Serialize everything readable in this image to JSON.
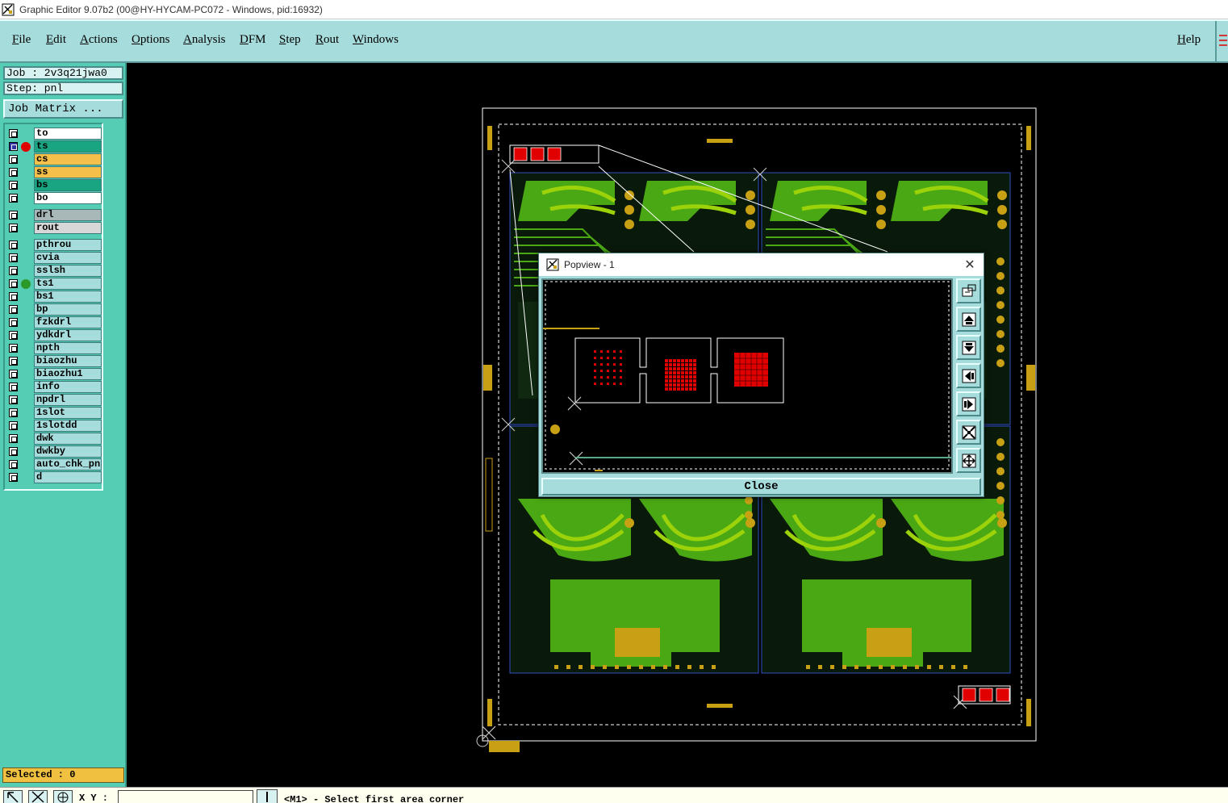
{
  "window": {
    "title": "Graphic Editor 9.07b2 (00@HY-HYCAM-PC072 - Windows, pid:16932)"
  },
  "menu": {
    "items": [
      "File",
      "Edit",
      "Actions",
      "Options",
      "Analysis",
      "DFM",
      "Step",
      "Rout",
      "Windows"
    ],
    "help": "Help"
  },
  "job": {
    "job_label": "Job : 2v3q21jwa0",
    "step_label": "Step: pnl",
    "matrix_button": "Job Matrix ..."
  },
  "layers": [
    {
      "name": "to",
      "color": "#ffffff",
      "dot": ""
    },
    {
      "name": "ts",
      "color": "#1aa582",
      "dot": "#e00000",
      "active": true
    },
    {
      "name": "cs",
      "color": "#f5c04a",
      "dot": ""
    },
    {
      "name": "ss",
      "color": "#f5c04a",
      "dot": ""
    },
    {
      "name": "bs",
      "color": "#1aa582",
      "dot": ""
    },
    {
      "name": "bo",
      "color": "#ffffff",
      "dot": ""
    },
    {
      "name": "drl",
      "color": "#a8b8b8",
      "dot": ""
    },
    {
      "name": "rout",
      "color": "#d8d8d8",
      "dot": ""
    },
    {
      "name": "pthrou",
      "color": "#a6dcdc",
      "dot": ""
    },
    {
      "name": "cvia",
      "color": "#a6dcdc",
      "dot": ""
    },
    {
      "name": "sslsh",
      "color": "#a6dcdc",
      "dot": ""
    },
    {
      "name": "ts1",
      "color": "#a6dcdc",
      "dot": "#2a9a2a"
    },
    {
      "name": "bs1",
      "color": "#a6dcdc",
      "dot": ""
    },
    {
      "name": "bp",
      "color": "#a6dcdc",
      "dot": ""
    },
    {
      "name": "fzkdrl",
      "color": "#a6dcdc",
      "dot": ""
    },
    {
      "name": "ydkdrl",
      "color": "#a6dcdc",
      "dot": ""
    },
    {
      "name": "npth",
      "color": "#a6dcdc",
      "dot": ""
    },
    {
      "name": "biaozhu",
      "color": "#a6dcdc",
      "dot": ""
    },
    {
      "name": "biaozhu1",
      "color": "#a6dcdc",
      "dot": ""
    },
    {
      "name": "info",
      "color": "#a6dcdc",
      "dot": ""
    },
    {
      "name": "npdrl",
      "color": "#a6dcdc",
      "dot": ""
    },
    {
      "name": "1slot",
      "color": "#a6dcdc",
      "dot": ""
    },
    {
      "name": "1slotdd",
      "color": "#a6dcdc",
      "dot": ""
    },
    {
      "name": "dwk",
      "color": "#a6dcdc",
      "dot": ""
    },
    {
      "name": "dwkby",
      "color": "#a6dcdc",
      "dot": ""
    },
    {
      "name": "auto_chk_pnl",
      "color": "#a6dcdc",
      "dot": ""
    },
    {
      "name": "d",
      "color": "#a6dcdc",
      "dot": ""
    }
  ],
  "selected": "Selected : 0",
  "status": {
    "xy_label": "X Y :",
    "message": "<M1> - Select first area corner"
  },
  "popview": {
    "title": "Popview - 1",
    "close_button": "Close",
    "tools": [
      "zoom-window-icon",
      "pan-up-icon",
      "pan-down-icon",
      "pan-left-icon",
      "pan-right-icon",
      "zoom-fit-icon",
      "zoom-out-icon"
    ]
  },
  "colors": {
    "copper": "#4aa814",
    "trace": "#9cd20a",
    "pad": "#c8a014",
    "outline": "#ffffff",
    "red_pad": "#e00000"
  }
}
